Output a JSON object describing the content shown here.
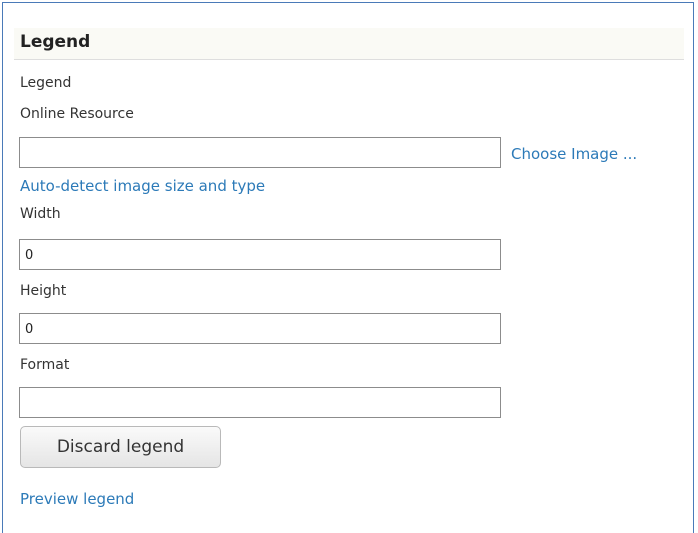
{
  "section": {
    "title": "Legend"
  },
  "fields": {
    "legend_label": "Legend",
    "online_resource": {
      "label": "Online Resource",
      "value": "",
      "choose_image_link": "Choose Image ..."
    },
    "auto_detect_link": "Auto-detect image size and type",
    "width": {
      "label": "Width",
      "value": "0"
    },
    "height": {
      "label": "Height",
      "value": "0"
    },
    "format": {
      "label": "Format",
      "value": ""
    }
  },
  "actions": {
    "discard_label": "Discard legend",
    "preview_link": "Preview legend"
  },
  "colors": {
    "link": "#2c7ab8",
    "frame_border": "#4a7ab8",
    "header_background": "#fafaf5"
  }
}
